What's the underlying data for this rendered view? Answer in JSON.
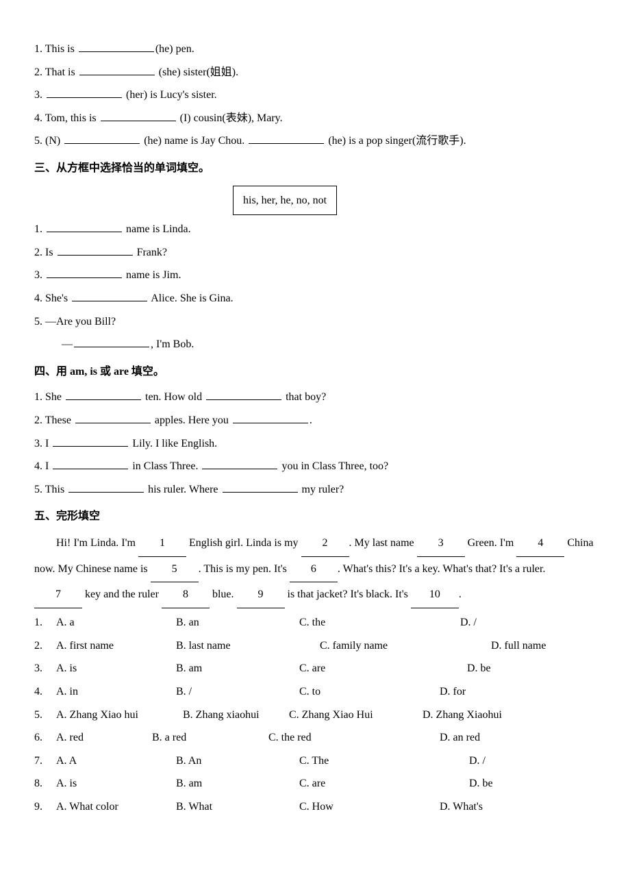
{
  "section2": {
    "items": [
      {
        "num": "1.",
        "pre": "This is ",
        "hint": "(he)",
        "post": " pen."
      },
      {
        "num": "2.",
        "pre": "That is ",
        "hint": " (she)",
        "post": " sister(姐姐)."
      },
      {
        "num": "3.",
        "pre": "",
        "hint": " (her)",
        "post": " is Lucy's sister."
      },
      {
        "num": "4.",
        "pre": "Tom, this is ",
        "hint": " (I)",
        "post": " cousin(表妹), Mary."
      },
      {
        "num": "5.",
        "pre": "(N) ",
        "hint": " (he)",
        "mid": " name is Jay Chou. ",
        "hint2": " (he)",
        "post2": " is a pop singer(流行歌手)."
      }
    ]
  },
  "section3": {
    "heading": "三、从方框中选择恰当的单词填空。",
    "box": "his, her, he, no, not",
    "items": [
      {
        "num": "1.",
        "post": " name is Linda."
      },
      {
        "num": "2.",
        "pre": "Is ",
        "post": " Frank?"
      },
      {
        "num": "3.",
        "post": " name is Jim."
      },
      {
        "num": "4.",
        "pre": "She's ",
        "post": " Alice. She is Gina."
      },
      {
        "num": "5.",
        "line1": "—Are you Bill?",
        "line2pre": "—",
        "line2post": ", I'm Bob."
      }
    ]
  },
  "section4": {
    "heading": "四、用 am, is 或 are 填空。",
    "items": [
      {
        "num": "1.",
        "t1": "She ",
        "t2": " ten. How old ",
        "t3": " that boy?"
      },
      {
        "num": "2.",
        "t1": "These ",
        "t2": " apples. Here you ",
        "t3": "."
      },
      {
        "num": "3.",
        "t1": "I ",
        "t2": " Lily. I like English."
      },
      {
        "num": "4.",
        "t1": "I ",
        "t2": " in Class Three. ",
        "t3": " you in Class Three, too?"
      },
      {
        "num": "5.",
        "t1": "This ",
        "t2": " his ruler. Where ",
        "t3": " my ruler?"
      }
    ]
  },
  "section5": {
    "heading": "五、完形填空",
    "passage": {
      "p1a": "Hi! I'm Linda. I'm ",
      "p1b": " English girl. Linda is my ",
      "p1c": ". My last name ",
      "p1d": " Green.",
      "p2a": "I'm ",
      "p2b": " China now. My Chinese name is ",
      "p2c": ". This is my pen. It's ",
      "p2d": ". What's this?",
      "p3a": "It's a key. What's that? It's a ruler. ",
      "p3b": " key and the ruler ",
      "p3c": " blue. ",
      "p3d": " is that",
      "p4a": "jacket? It's black. It's ",
      "p4b": "."
    },
    "choices": [
      {
        "num": "1.",
        "a": "A. a",
        "b": "B. an",
        "c": "C. the",
        "d": "D. /",
        "wa": 175,
        "wb": 180,
        "wc": 235,
        "wd": 150
      },
      {
        "num": "2.",
        "a": "A. first name",
        "b": "B. last name",
        "c": "C. family name",
        "d": "D. full name",
        "wa": 175,
        "wb": 210,
        "wc": 250,
        "wd": 150
      },
      {
        "num": "3.",
        "a": "A. is",
        "b": "B. am",
        "c": "C. are",
        "d": "D. be",
        "wa": 175,
        "wb": 180,
        "wc": 245,
        "wd": 150
      },
      {
        "num": "4.",
        "a": "A. in",
        "b": "B. /",
        "c": "C. to",
        "d": "D. for",
        "wa": 175,
        "wb": 180,
        "wc": 205,
        "wd": 150
      },
      {
        "num": "5.",
        "a": "A. Zhang Xiao hui",
        "b": "B. Zhang xiaohui",
        "c": "C. Zhang Xiao Hui",
        "d": "D. Zhang Xiaohui",
        "wa": 185,
        "wb": 155,
        "wc": 195,
        "wd": 160
      },
      {
        "num": "6.",
        "a": "A. red",
        "b": "B. a red",
        "c": "C. the red",
        "d": "D. an red",
        "wa": 140,
        "wb": 170,
        "wc": 250,
        "wd": 150
      },
      {
        "num": "7.",
        "a": "A. A",
        "b": "B. An",
        "c": "C. The",
        "d": "D. /",
        "wa": 175,
        "wb": 180,
        "wc": 248,
        "wd": 150
      },
      {
        "num": "8.",
        "a": "A. is",
        "b": "B. am",
        "c": "C. are",
        "d": "D. be",
        "wa": 175,
        "wb": 180,
        "wc": 248,
        "wd": 150
      },
      {
        "num": "9.",
        "a": "A. What color",
        "b": "B. What",
        "c": "C. How",
        "d": "D. What's",
        "wa": 175,
        "wb": 180,
        "wc": 205,
        "wd": 150
      }
    ]
  }
}
